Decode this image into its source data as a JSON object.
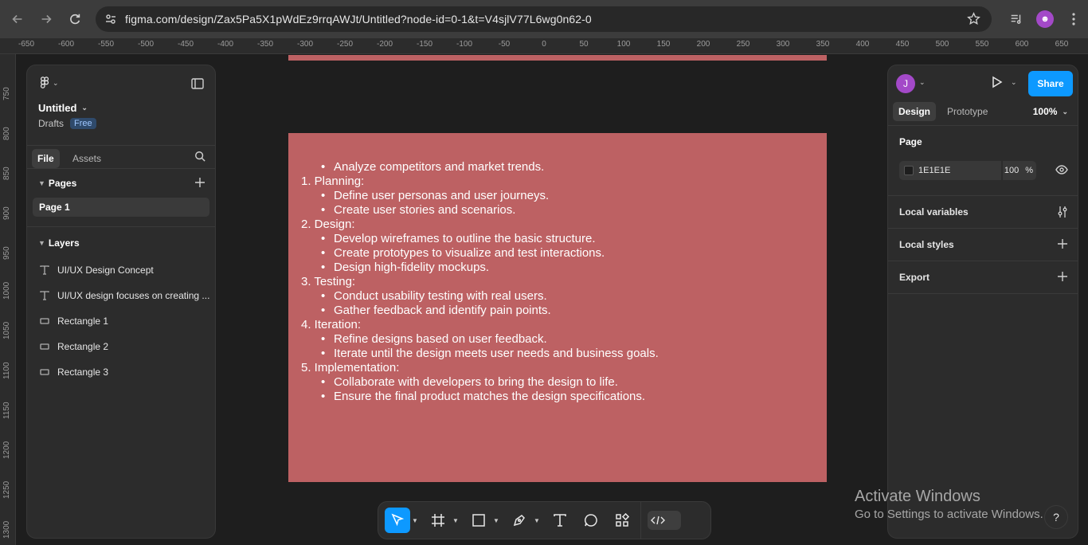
{
  "browser": {
    "url": "figma.com/design/Zax5Pa5X1pWdEz9rrqAWJt/Untitled?node-id=0-1&t=V4sjlV77L6wg0n62-0"
  },
  "ruler": {
    "x_ticks": [
      "-650",
      "-600",
      "-550",
      "-500",
      "-450",
      "-400",
      "-350",
      "-300",
      "-250",
      "-200",
      "-150",
      "-100",
      "-50",
      "0",
      "50",
      "100",
      "150",
      "200",
      "250",
      "300",
      "350",
      "400",
      "450",
      "500",
      "550",
      "600",
      "650"
    ],
    "y_ticks": [
      "750",
      "800",
      "850",
      "900",
      "950",
      "1000",
      "1050",
      "1100",
      "1150",
      "1200",
      "1250",
      "1300"
    ]
  },
  "left_panel": {
    "file_title": "Untitled",
    "drafts_label": "Drafts",
    "plan_badge": "Free",
    "tabs": {
      "file": "File",
      "assets": "Assets"
    },
    "pages_heading": "Pages",
    "pages": [
      "Page 1"
    ],
    "layers_heading": "Layers",
    "layers": [
      {
        "type": "text",
        "label": "UI/UX Design Concept"
      },
      {
        "type": "text",
        "label": "UI/UX design focuses on creating ..."
      },
      {
        "type": "rect",
        "label": "Rectangle 1"
      },
      {
        "type": "rect",
        "label": "Rectangle 2"
      },
      {
        "type": "rect",
        "label": "Rectangle 3"
      }
    ]
  },
  "right_panel": {
    "avatar_initial": "J",
    "share_label": "Share",
    "tabs": {
      "design": "Design",
      "prototype": "Prototype"
    },
    "zoom": "100%",
    "page_heading": "Page",
    "bg_color": "1E1E1E",
    "bg_opacity": "100",
    "opacity_unit": "%",
    "rows": {
      "local_variables": "Local variables",
      "local_styles": "Local styles",
      "export": "Export"
    }
  },
  "canvas": {
    "frame_color": "#bd6163",
    "lines": [
      {
        "level": "sub",
        "text": "Analyze competitors and market trends."
      },
      {
        "level": "num",
        "text": "1. Planning:"
      },
      {
        "level": "sub",
        "text": "Define user personas and user journeys."
      },
      {
        "level": "sub",
        "text": "Create user stories and scenarios."
      },
      {
        "level": "num",
        "text": "2. Design:"
      },
      {
        "level": "sub",
        "text": "Develop wireframes to outline the basic structure."
      },
      {
        "level": "sub",
        "text": "Create prototypes to visualize and test interactions."
      },
      {
        "level": "sub",
        "text": "Design high-fidelity mockups."
      },
      {
        "level": "num",
        "text": "3. Testing:"
      },
      {
        "level": "sub",
        "text": "Conduct usability testing with real users."
      },
      {
        "level": "sub",
        "text": "Gather feedback and identify pain points."
      },
      {
        "level": "num",
        "text": "4. Iteration:"
      },
      {
        "level": "sub",
        "text": "Refine designs based on user feedback."
      },
      {
        "level": "sub",
        "text": "Iterate until the design meets user needs and business goals."
      },
      {
        "level": "num",
        "text": "5. Implementation:"
      },
      {
        "level": "sub",
        "text": "Collaborate with developers to bring the design to life."
      },
      {
        "level": "sub",
        "text": "Ensure the final product matches the design specifications."
      }
    ]
  },
  "watermark": {
    "title": "Activate Windows",
    "subtitle": "Go to Settings to activate Windows."
  },
  "help": "?",
  "colors": {
    "accent": "#0d99ff",
    "panel": "#2c2c2c",
    "canvas": "#1e1e1e",
    "avatar": "#a349c8"
  }
}
